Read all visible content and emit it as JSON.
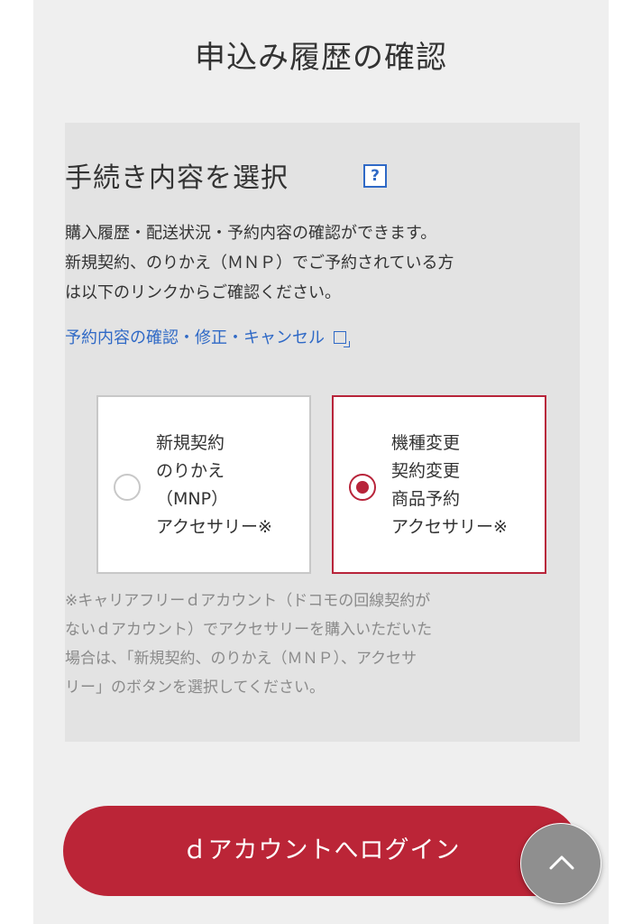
{
  "page": {
    "title": "申込み履歴の確認"
  },
  "section": {
    "heading": "手続き内容を選択",
    "help_label": "?",
    "intro_lines": [
      "購入履歴・配送状況・予約内容の確認ができます。",
      "新規契約、のりかえ（ＭＮＰ）でご予約されている方",
      "は以下のリンクからご確認ください。"
    ],
    "reservation_link": "予約内容の確認・修正・キャンセル"
  },
  "options": [
    {
      "lines": [
        "新規契約",
        "のりかえ",
        "（MNP）",
        "アクセサリー※"
      ],
      "selected": false
    },
    {
      "lines": [
        "機種変更",
        "契約変更",
        "商品予約",
        "アクセサリー※"
      ],
      "selected": true
    }
  ],
  "note_lines": [
    "※キャリアフリーｄアカウント（ドコモの回線契約が",
    "ないｄアカウント）でアクセサリーを購入いただいた",
    "場合は、「新規契約、のりかえ（ＭＮＰ）、アクセサ",
    "リー」のボタンを選択してください。"
  ],
  "login_button": "ｄアカウントへログイン",
  "colors": {
    "accent": "#bb2537",
    "link": "#2f69c6",
    "panel": "#e3e3e3",
    "page_bg": "#efefef"
  },
  "icons": {
    "help": "question-mark-icon",
    "external": "external-link-icon",
    "scroll_top": "chevron-up-icon"
  }
}
